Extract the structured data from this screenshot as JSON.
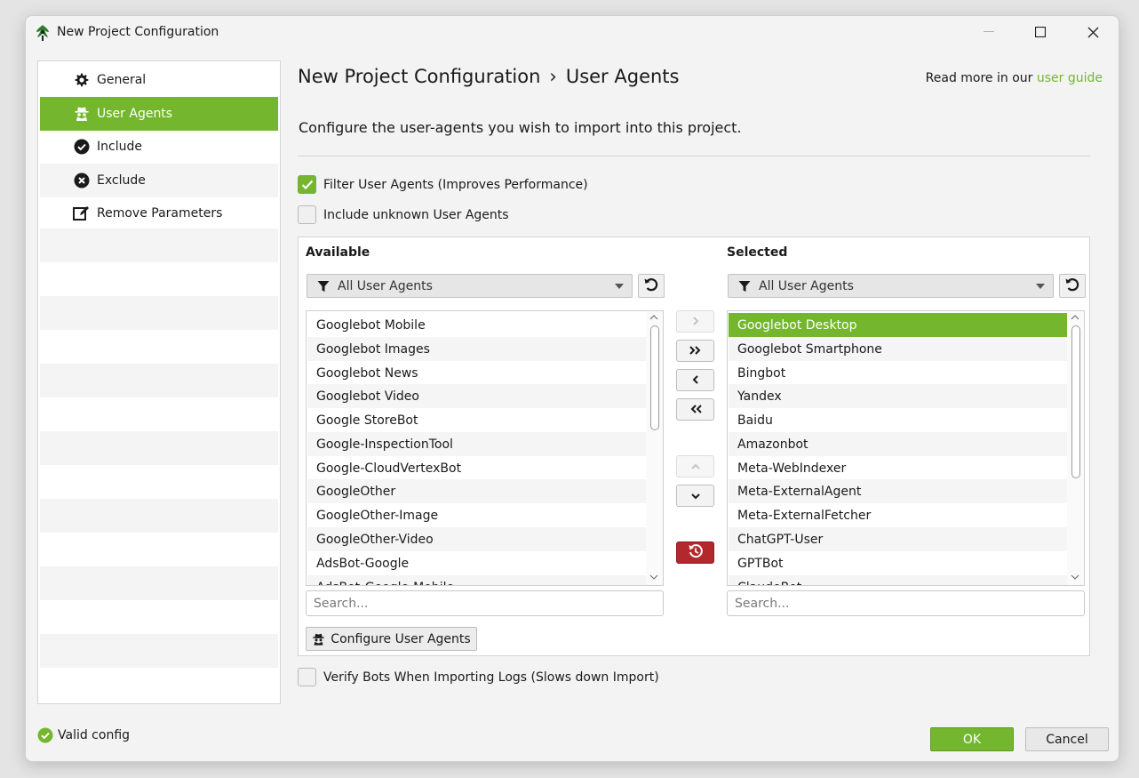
{
  "window": {
    "title": "New Project Configuration",
    "accent_color": "#74b72e",
    "danger_color": "#b3282d"
  },
  "sidebar": {
    "items": [
      {
        "label": "General",
        "icon": "gear-icon",
        "active": false
      },
      {
        "label": "User Agents",
        "icon": "spy-icon",
        "active": true
      },
      {
        "label": "Include",
        "icon": "check-circle-icon",
        "active": false
      },
      {
        "label": "Exclude",
        "icon": "x-circle-icon",
        "active": false
      },
      {
        "label": "Remove Parameters",
        "icon": "edit-icon",
        "active": false
      }
    ]
  },
  "header": {
    "crumb_root": "New Project Configuration",
    "crumb_sep": "›",
    "crumb_current": "User Agents",
    "guide_prefix": "Read more in our",
    "guide_link": "user guide",
    "description": "Configure the user-agents you wish to import into this project."
  },
  "options": {
    "filter_label": "Filter User Agents (Improves Performance)",
    "filter_checked": true,
    "unknown_label": "Include unknown User Agents",
    "unknown_checked": false,
    "verify_label": "Verify Bots When Importing Logs (Slows down Import)",
    "verify_checked": false
  },
  "available": {
    "title": "Available",
    "filter_value": "All User Agents",
    "search_placeholder": "Search...",
    "items": [
      "Googlebot Mobile",
      "Googlebot Images",
      "Googlebot News",
      "Googlebot Video",
      "Google StoreBot",
      "Google-InspectionTool",
      "Google-CloudVertexBot",
      "GoogleOther",
      "GoogleOther-Image",
      "GoogleOther-Video",
      "AdsBot-Google",
      "AdsBot-Google-Mobile"
    ]
  },
  "selected": {
    "title": "Selected",
    "filter_value": "All User Agents",
    "search_placeholder": "Search...",
    "selected_index": 0,
    "items": [
      "Googlebot Desktop",
      "Googlebot Smartphone",
      "Bingbot",
      "Yandex",
      "Baidu",
      "Amazonbot",
      "Meta-WebIndexer",
      "Meta-ExternalAgent",
      "Meta-ExternalFetcher",
      "ChatGPT-User",
      "GPTBot",
      "ClaudeBot"
    ]
  },
  "config_button_label": "Configure User Agents",
  "footer": {
    "status": "Valid config",
    "ok_label": "OK",
    "cancel_label": "Cancel"
  }
}
